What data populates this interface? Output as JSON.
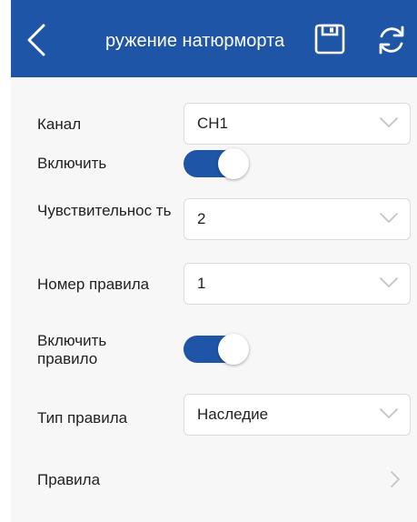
{
  "header": {
    "title": "ружение натюрморта",
    "back_icon": "chevron-left-icon",
    "save_icon": "save-icon",
    "refresh_icon": "refresh-icon",
    "color": "#1f55a6"
  },
  "form": {
    "channel": {
      "label": "Канал",
      "value": "CH1"
    },
    "enable": {
      "label": "Включить",
      "on": true
    },
    "sensitivity": {
      "label": "Чувствительнос ть",
      "value": "2"
    },
    "rule_number": {
      "label": "Номер правила",
      "value": "1"
    },
    "enable_rule": {
      "label": "Включить правило",
      "on": true
    },
    "rule_type": {
      "label": "Тип правила",
      "value": "Наследие"
    },
    "rules": {
      "label": "Правила"
    }
  }
}
